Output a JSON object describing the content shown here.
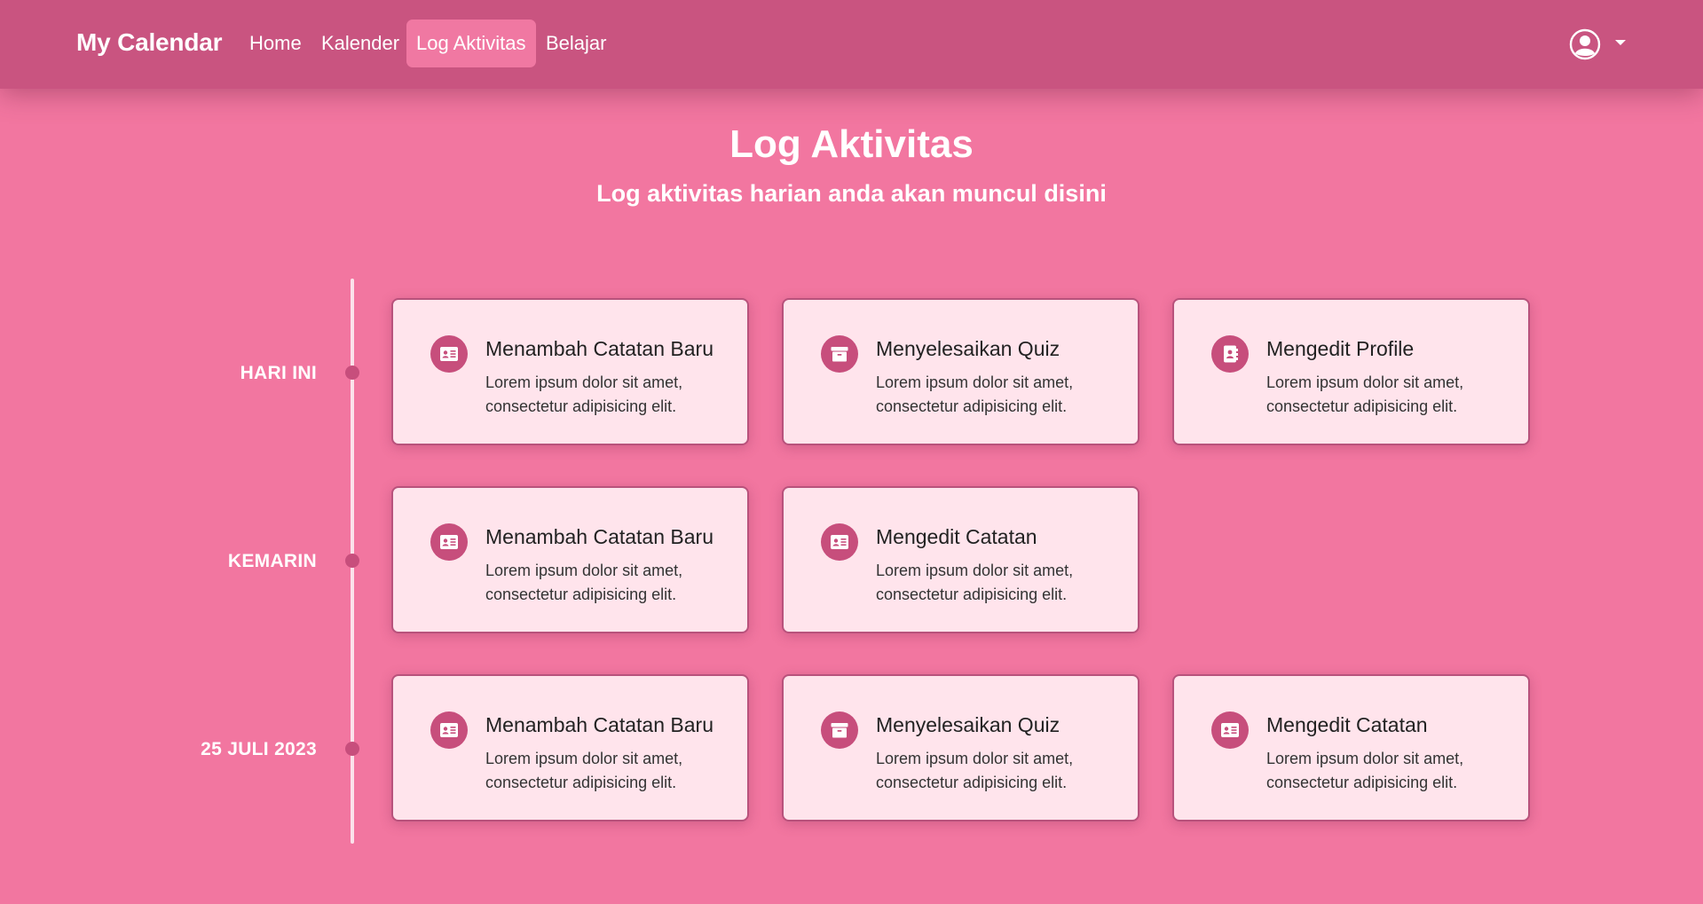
{
  "navbar": {
    "brand": "My Calendar",
    "items": [
      {
        "label": "Home"
      },
      {
        "label": "Kalender"
      },
      {
        "label": "Log Aktivitas",
        "active": true
      },
      {
        "label": "Belajar"
      }
    ],
    "user_icon": "user-circle-icon"
  },
  "header": {
    "title": "Log Aktivitas",
    "subtitle": "Log aktivitas harian anda akan muncul disini"
  },
  "colors": {
    "background": "#f276a0",
    "navbar": "#c95480",
    "card_bg": "#ffe4ec",
    "accent": "#c74e7c"
  },
  "timeline": [
    {
      "label": "HARI INI",
      "activities": [
        {
          "title": "Menambah Catatan Baru",
          "text": "Lorem ipsum dolor sit amet, consectetur adipisicing elit.",
          "icon": "id-card-icon"
        },
        {
          "title": "Menyelesaikan Quiz",
          "text": "Lorem ipsum dolor sit amet, consectetur adipisicing elit.",
          "icon": "archive-box-icon"
        },
        {
          "title": "Mengedit Profile",
          "text": "Lorem ipsum dolor sit amet, consectetur adipisicing elit.",
          "icon": "contact-book-icon"
        }
      ]
    },
    {
      "label": "KEMARIN",
      "activities": [
        {
          "title": "Menambah Catatan Baru",
          "text": "Lorem ipsum dolor sit amet, consectetur adipisicing elit.",
          "icon": "id-card-icon"
        },
        {
          "title": "Mengedit Catatan",
          "text": "Lorem ipsum dolor sit amet, consectetur adipisicing elit.",
          "icon": "id-card-icon"
        }
      ]
    },
    {
      "label": "25 JULI 2023",
      "activities": [
        {
          "title": "Menambah Catatan Baru",
          "text": "Lorem ipsum dolor sit amet, consectetur adipisicing elit.",
          "icon": "id-card-icon"
        },
        {
          "title": "Menyelesaikan Quiz",
          "text": "Lorem ipsum dolor sit amet, consectetur adipisicing elit.",
          "icon": "archive-box-icon"
        },
        {
          "title": "Mengedit Catatan",
          "text": "Lorem ipsum dolor sit amet, consectetur adipisicing elit.",
          "icon": "id-card-icon"
        }
      ]
    }
  ]
}
